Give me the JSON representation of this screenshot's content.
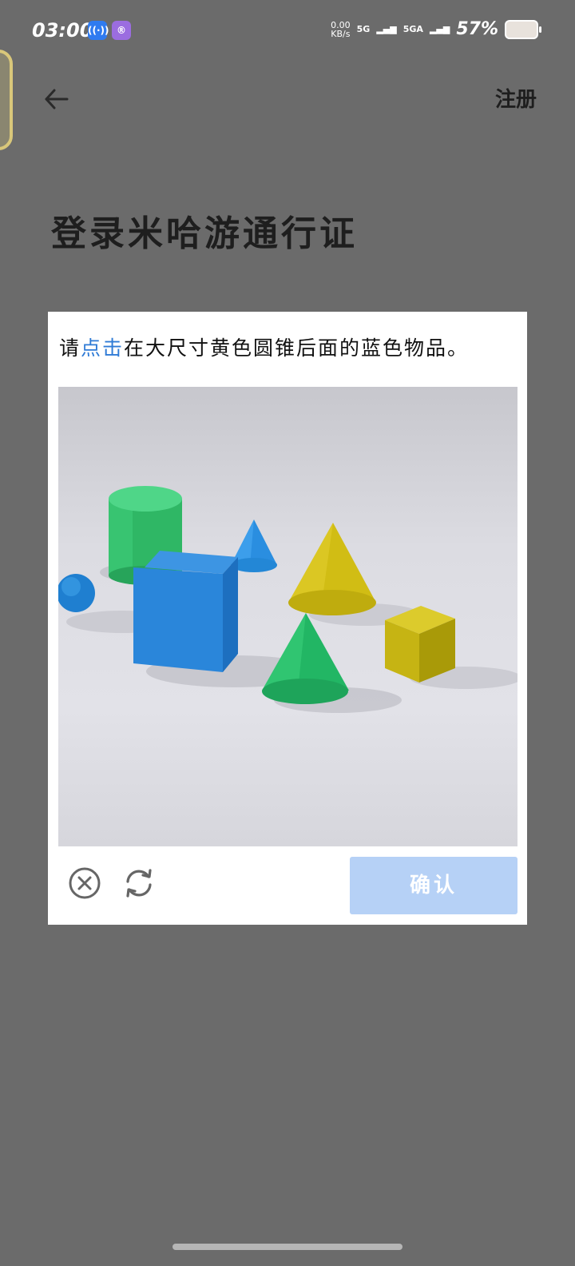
{
  "status_bar": {
    "time": "03:00",
    "net_speed_value": "0.00",
    "net_speed_unit": "KB/s",
    "signal1": "5G",
    "signal2": "5GA",
    "battery": "57%",
    "app_icon_1": "broadcast-icon",
    "app_icon_2": "app-icon"
  },
  "header": {
    "back_icon": "arrow-left-icon",
    "register_label": "注册"
  },
  "page": {
    "title": "登录米哈游通行证"
  },
  "captcha": {
    "instruction_prefix": "请",
    "instruction_highlight": "点击",
    "instruction_suffix": "在大尺寸黄色圆锥后面的蓝色物品。",
    "highlight_color": "#2f7bd6",
    "close_icon": "close-circle-icon",
    "refresh_icon": "refresh-icon",
    "confirm_label": "确认",
    "confirm_color": "#b6d1f6"
  }
}
